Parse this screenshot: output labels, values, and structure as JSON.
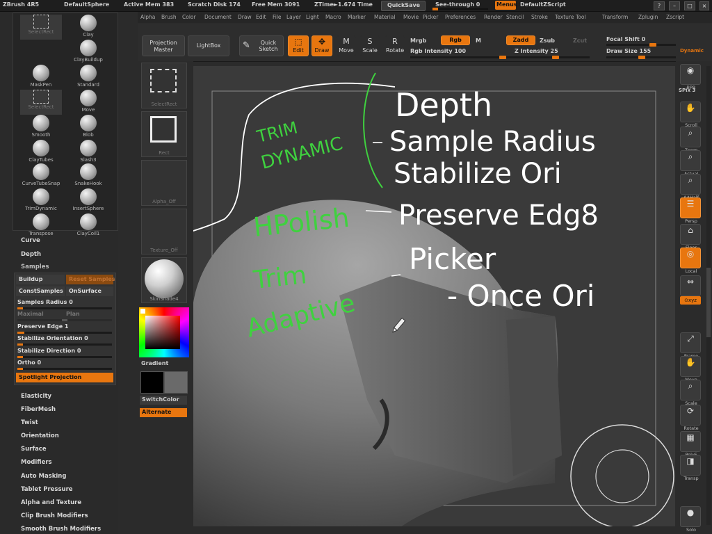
{
  "titlebar": {
    "app": "ZBrush 4R5",
    "doc": "DefaultSphere",
    "active_mem": "Active Mem 383",
    "scratch_disk": "Scratch Disk 174",
    "free_mem": "Free Mem 3091",
    "ztime": "ZTime►1.674 Time",
    "quicksave": "QuickSave",
    "see_through": "See-through  0",
    "menus": "Menus",
    "default_zscript": "DefaultZScript"
  },
  "menubar": [
    "Alpha",
    "Brush",
    "Color",
    "Document",
    "Draw",
    "Edit",
    "File",
    "Layer",
    "Light",
    "Macro",
    "Marker",
    "Material",
    "Movie",
    "Picker",
    "Preferences",
    "Render",
    "Stencil",
    "Stroke",
    "Texture",
    "Tool",
    "Transform",
    "Zplugin",
    "Zscript"
  ],
  "toolbar": {
    "projection_master": "Projection Master",
    "lightbox": "LightBox",
    "quick_sketch": "Quick Sketch",
    "edit": "Edit",
    "draw": "Draw",
    "move": "Move",
    "scale": "Scale",
    "rotate": "Rotate",
    "mrgb": "Mrgb",
    "rgb": "Rgb",
    "m": "M",
    "rgb_intensity": "Rgb Intensity 100",
    "zadd": "Zadd",
    "zsub": "Zsub",
    "zcut": "Zcut",
    "z_intensity": "Z Intensity 25",
    "focal_shift": "Focal Shift 0",
    "draw_size": "Draw Size 155",
    "dynamic": "Dynamic",
    "values": {
      "rgb_intensity": 100,
      "z_intensity": 25,
      "focal_shift": 0,
      "draw_size": 155
    }
  },
  "brushes": [
    {
      "label": "SelectRect",
      "selected": true
    },
    {
      "label": "Clay"
    },
    {
      "label": "ClayBuildup"
    },
    {
      "label": "MaskPen"
    },
    {
      "label": "Standard"
    },
    {
      "label": "SelectRect",
      "selected": true
    },
    {
      "label": "Move"
    },
    {
      "label": "Smooth"
    },
    {
      "label": "Blob"
    },
    {
      "label": "ClayTubes"
    },
    {
      "label": "Slash3"
    },
    {
      "label": "CurveTubeSnap"
    },
    {
      "label": "SnakeHook"
    },
    {
      "label": "TrimDynamic"
    },
    {
      "label": "InsertSphere"
    },
    {
      "label": "Transpose"
    },
    {
      "label": "ClayCoil1"
    }
  ],
  "leftmenu": {
    "curve": "Curve",
    "depth": "Depth",
    "samples": "Samples",
    "items": [
      "Elasticity",
      "FiberMesh",
      "Twist",
      "Orientation",
      "Surface",
      "Modifiers",
      "Auto Masking",
      "Tablet Pressure",
      "Alpha and Texture",
      "Clip Brush Modifiers",
      "Smooth Brush Modifiers"
    ]
  },
  "samples": {
    "buildup": "Buildup",
    "reset_samples": "Reset Samples",
    "const_samples": "ConstSamples",
    "on_surface": "OnSurface",
    "samples_radius": "Samples Radius 0",
    "maximal": "Maximal",
    "plan": "Plan",
    "preserve_edge": "Preserve Edge 1",
    "stabilize_orientation": "Stabilize Orientation 0",
    "stabilize_direction": "Stabilize Direction 0",
    "ortho": "Ortho 0",
    "spotlight_projection": "Spotlight Projection"
  },
  "col2": {
    "select_rect": "SelectRect",
    "rect": "Rect",
    "alpha_off": "Alpha_Off",
    "texture_off": "Texture_Off",
    "material": "SkinShade4",
    "gradient": "Gradient",
    "switch_color": "SwitchColor",
    "alternate": "Alternate"
  },
  "annotations": {
    "trim_dynamic_line1": "TRIM",
    "trim_dynamic_line2": "DYNAMIC",
    "depth": "Depth",
    "sample_radius": "Sample Radius",
    "stabilize_ori": "Stabilize Ori",
    "preserve_edge": "Preserve Edg8",
    "picker": "Picker",
    "once_ori": "- Once Ori",
    "hpolish": "HPolish",
    "trim_adaptive_line1": "Trim",
    "trim_adaptive_line2": "Adaptive"
  },
  "rightshelf": {
    "bpr": "BPR",
    "spix": "SPix 3",
    "scroll": "Scroll",
    "zoom": "Zoom",
    "actual": "Actual",
    "aahalf": "AAHalf",
    "persp": "Persp",
    "floor": "Floor",
    "local": "Local",
    "lsym": "L.Sym",
    "xyz": "⊙xyz",
    "frame": "Frame",
    "move": "Move",
    "scale": "Scale",
    "rotate": "Rotate",
    "polyf": "PolyF",
    "transp": "Transp",
    "solo": "Solo"
  },
  "colors": {
    "accent": "#e8760f",
    "annotation_white": "#ffffff",
    "annotation_green": "#3fd13f"
  }
}
